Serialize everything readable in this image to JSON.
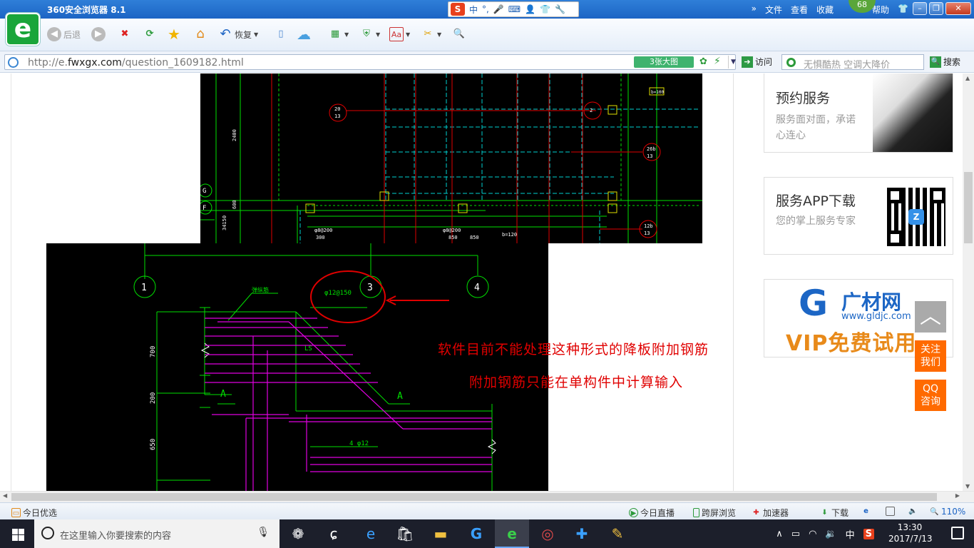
{
  "window": {
    "title": "360安全浏览器 8.1"
  },
  "ime": {
    "label": "中",
    "extra": "°,"
  },
  "menu": {
    "items": [
      "文件",
      "查看",
      "收藏",
      "帮助"
    ]
  },
  "badge": {
    "count": "68"
  },
  "toolbar": {
    "back": "后退",
    "restore": "恢复"
  },
  "address": {
    "url_host": "http://e.",
    "url_domain": "fwxgx.com",
    "url_path": "/question_1609182.html",
    "big_image": "3张大图",
    "visit": "访问"
  },
  "search": {
    "placeholder": "无惧酷热 空调大降价",
    "button": "搜索"
  },
  "cad": {
    "labels_top": [
      "20",
      "13",
      "2",
      "26b",
      "13",
      "12b",
      "13",
      "G",
      "F",
      "2400",
      "600",
      "34150",
      "300",
      "850",
      "850",
      "850",
      "φ8@200",
      "φ8@200",
      "b=120"
    ],
    "labels_bottom": [
      "1",
      "3",
      "4",
      "φ12@150",
      "弹纵筋",
      "700",
      "200",
      "650",
      "A",
      "A",
      "4 φ12",
      "LS"
    ]
  },
  "notes": {
    "line1": "软件目前不能处理这种形式的降板附加钢筋",
    "line2": "附加钢筋只能在单构件中计算输入"
  },
  "sidebar": {
    "card1": {
      "title": "预约服务",
      "sub": "服务面对面，承诺心连心"
    },
    "card2": {
      "title": "服务APP下载",
      "sub": "您的掌上服务专家"
    },
    "card3": {
      "brand_cn": "广材网",
      "brand_domain": "www.gldjc.com",
      "vip": "VIP免费试用"
    },
    "follow": "关注我们",
    "qq": "QQ咨询"
  },
  "statusbar": {
    "today": "今日优选",
    "live": "今日直播",
    "cross": "跨屏浏览",
    "accel": "加速器",
    "download": "下载",
    "zoom": "110%"
  },
  "taskbar": {
    "search_placeholder": "在这里输入你要搜索的内容",
    "ime": "中",
    "time": "13:30",
    "date": "2017/7/13"
  },
  "colors": {
    "accent": "#1c64c4",
    "note_red": "#e00000",
    "cad_green": "#00e000",
    "cad_magenta": "#e000e0",
    "cad_cyan": "#00d0d0",
    "orange": "#ff6a00"
  }
}
